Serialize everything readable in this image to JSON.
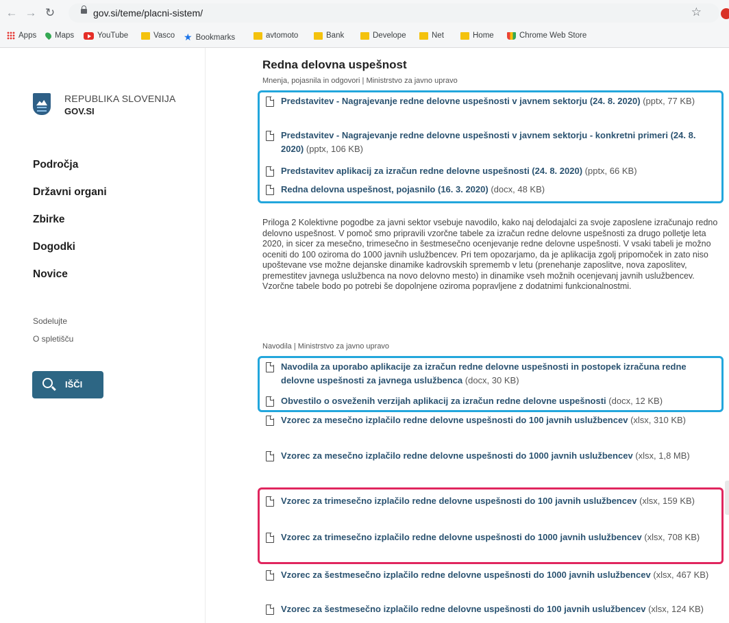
{
  "browser": {
    "url": "gov.si/teme/placni-sistem/",
    "bookmarks": [
      "Apps",
      "Maps",
      "YouTube",
      "Vasco",
      "Bookmarks",
      "avtomoto",
      "Bank",
      "Develope",
      "Net",
      "Home",
      "Chrome Web Store"
    ]
  },
  "sidebar": {
    "brand_line1": "REPUBLIKA SLOVENIJA",
    "brand_line2": "GOV.SI",
    "main_nav": [
      "Področja",
      "Državni organi",
      "Zbirke",
      "Dogodki",
      "Novice"
    ],
    "sub_nav": [
      "Sodelujte",
      "O spletišču"
    ],
    "search_label": "IŠČI"
  },
  "content": {
    "title": "Redna delovna uspešnost",
    "meta1": "Mnenja, pojasnila in odgovori | Ministrstvo za javno upravo",
    "group1": [
      {
        "link": "Predstavitev - Nagrajevanje redne delovne uspešnosti v javnem sektorju (24. 8. 2020)",
        "meta": "(pptx, 77 KB)"
      },
      {
        "link": "Predstavitev - Nagrajevanje redne delovne uspešnosti v javnem sektorju - konkretni primeri (24. 8. 2020)",
        "meta": "(pptx, 106 KB)"
      },
      {
        "link": "Predstavitev aplikacij za izračun redne delovne uspešnosti (24. 8. 2020)",
        "meta": "(pptx, 66 KB)"
      },
      {
        "link": "Redna delovna uspešnost, pojasnilo (16. 3. 2020)",
        "meta": "(docx, 48 KB)"
      }
    ],
    "body": "Priloga 2 Kolektivne pogodbe za javni sektor vsebuje navodilo, kako naj delodajalci za svoje zaposlene izračunajo redno delovno uspešnost. V pomoč smo pripravili vzorčne tabele za izračun redne delovne uspešnosti za drugo polletje leta 2020, in sicer za mesečno, trimesečno in šestmesečno ocenjevanje redne delovne uspešnosti. V vsaki tabeli je možno oceniti do 100 oziroma do 1000 javnih uslužbencev. Pri tem opozarjamo, da je aplikacija zgolj pripomoček in zato niso upoštevane vse možne dejanske dinamike kadrovskih sprememb v letu (prenehanje zaposlitve, nova zaposlitev, premestitev javnega uslužbenca na novo delovno mesto) in dinamike vseh možnih ocenjevanj javnih uslužbencev. Vzorčne tabele bodo po potrebi še dopolnjene oziroma popravljene z dodatnimi funkcionalnostmi.",
    "meta2": "Navodila | Ministrstvo za javno upravo",
    "group2": [
      {
        "link": "Navodila za uporabo aplikacije za izračun redne delovne uspešnosti in postopek izračuna redne delovne uspešnosti za javnega uslužbenca",
        "meta": "(docx, 30 KB)"
      },
      {
        "link": "Obvestilo o osveženih verzijah aplikacij za izračun redne delovne uspešnosti",
        "meta": "(docx, 12 KB)"
      },
      {
        "link": "Vzorec za mesečno izplačilo redne delovne uspešnosti do 100 javnih uslužbencev",
        "meta": "(xlsx, 310 KB)"
      },
      {
        "link": "Vzorec za mesečno izplačilo redne delovne uspešnosti do 1000 javnih uslužbencev",
        "meta": "(xlsx, 1,8 MB)"
      },
      {
        "link": "Vzorec za trimesečno izplačilo redne delovne uspešnosti do 100 javnih uslužbencev",
        "meta": "(xlsx, 159 KB)"
      },
      {
        "link": "Vzorec za trimesečno izplačilo redne delovne uspešnosti do 1000 javnih uslužbencev",
        "meta": "(xlsx, 708 KB)"
      },
      {
        "link": "Vzorec za šestmesečno izplačilo redne delovne uspešnosti do 1000 javnih uslužbencev",
        "meta": "(xlsx, 467 KB)"
      },
      {
        "link": "Vzorec za šestmesečno izplačilo redne delovne uspešnosti do 100 javnih uslužbencev",
        "meta": "(xlsx, 124 KB)"
      }
    ]
  },
  "colors": {
    "link": "#2a5270",
    "highlight_blue": "#22a6dc",
    "highlight_pink": "#e0265e",
    "search_button": "#2d6684"
  }
}
